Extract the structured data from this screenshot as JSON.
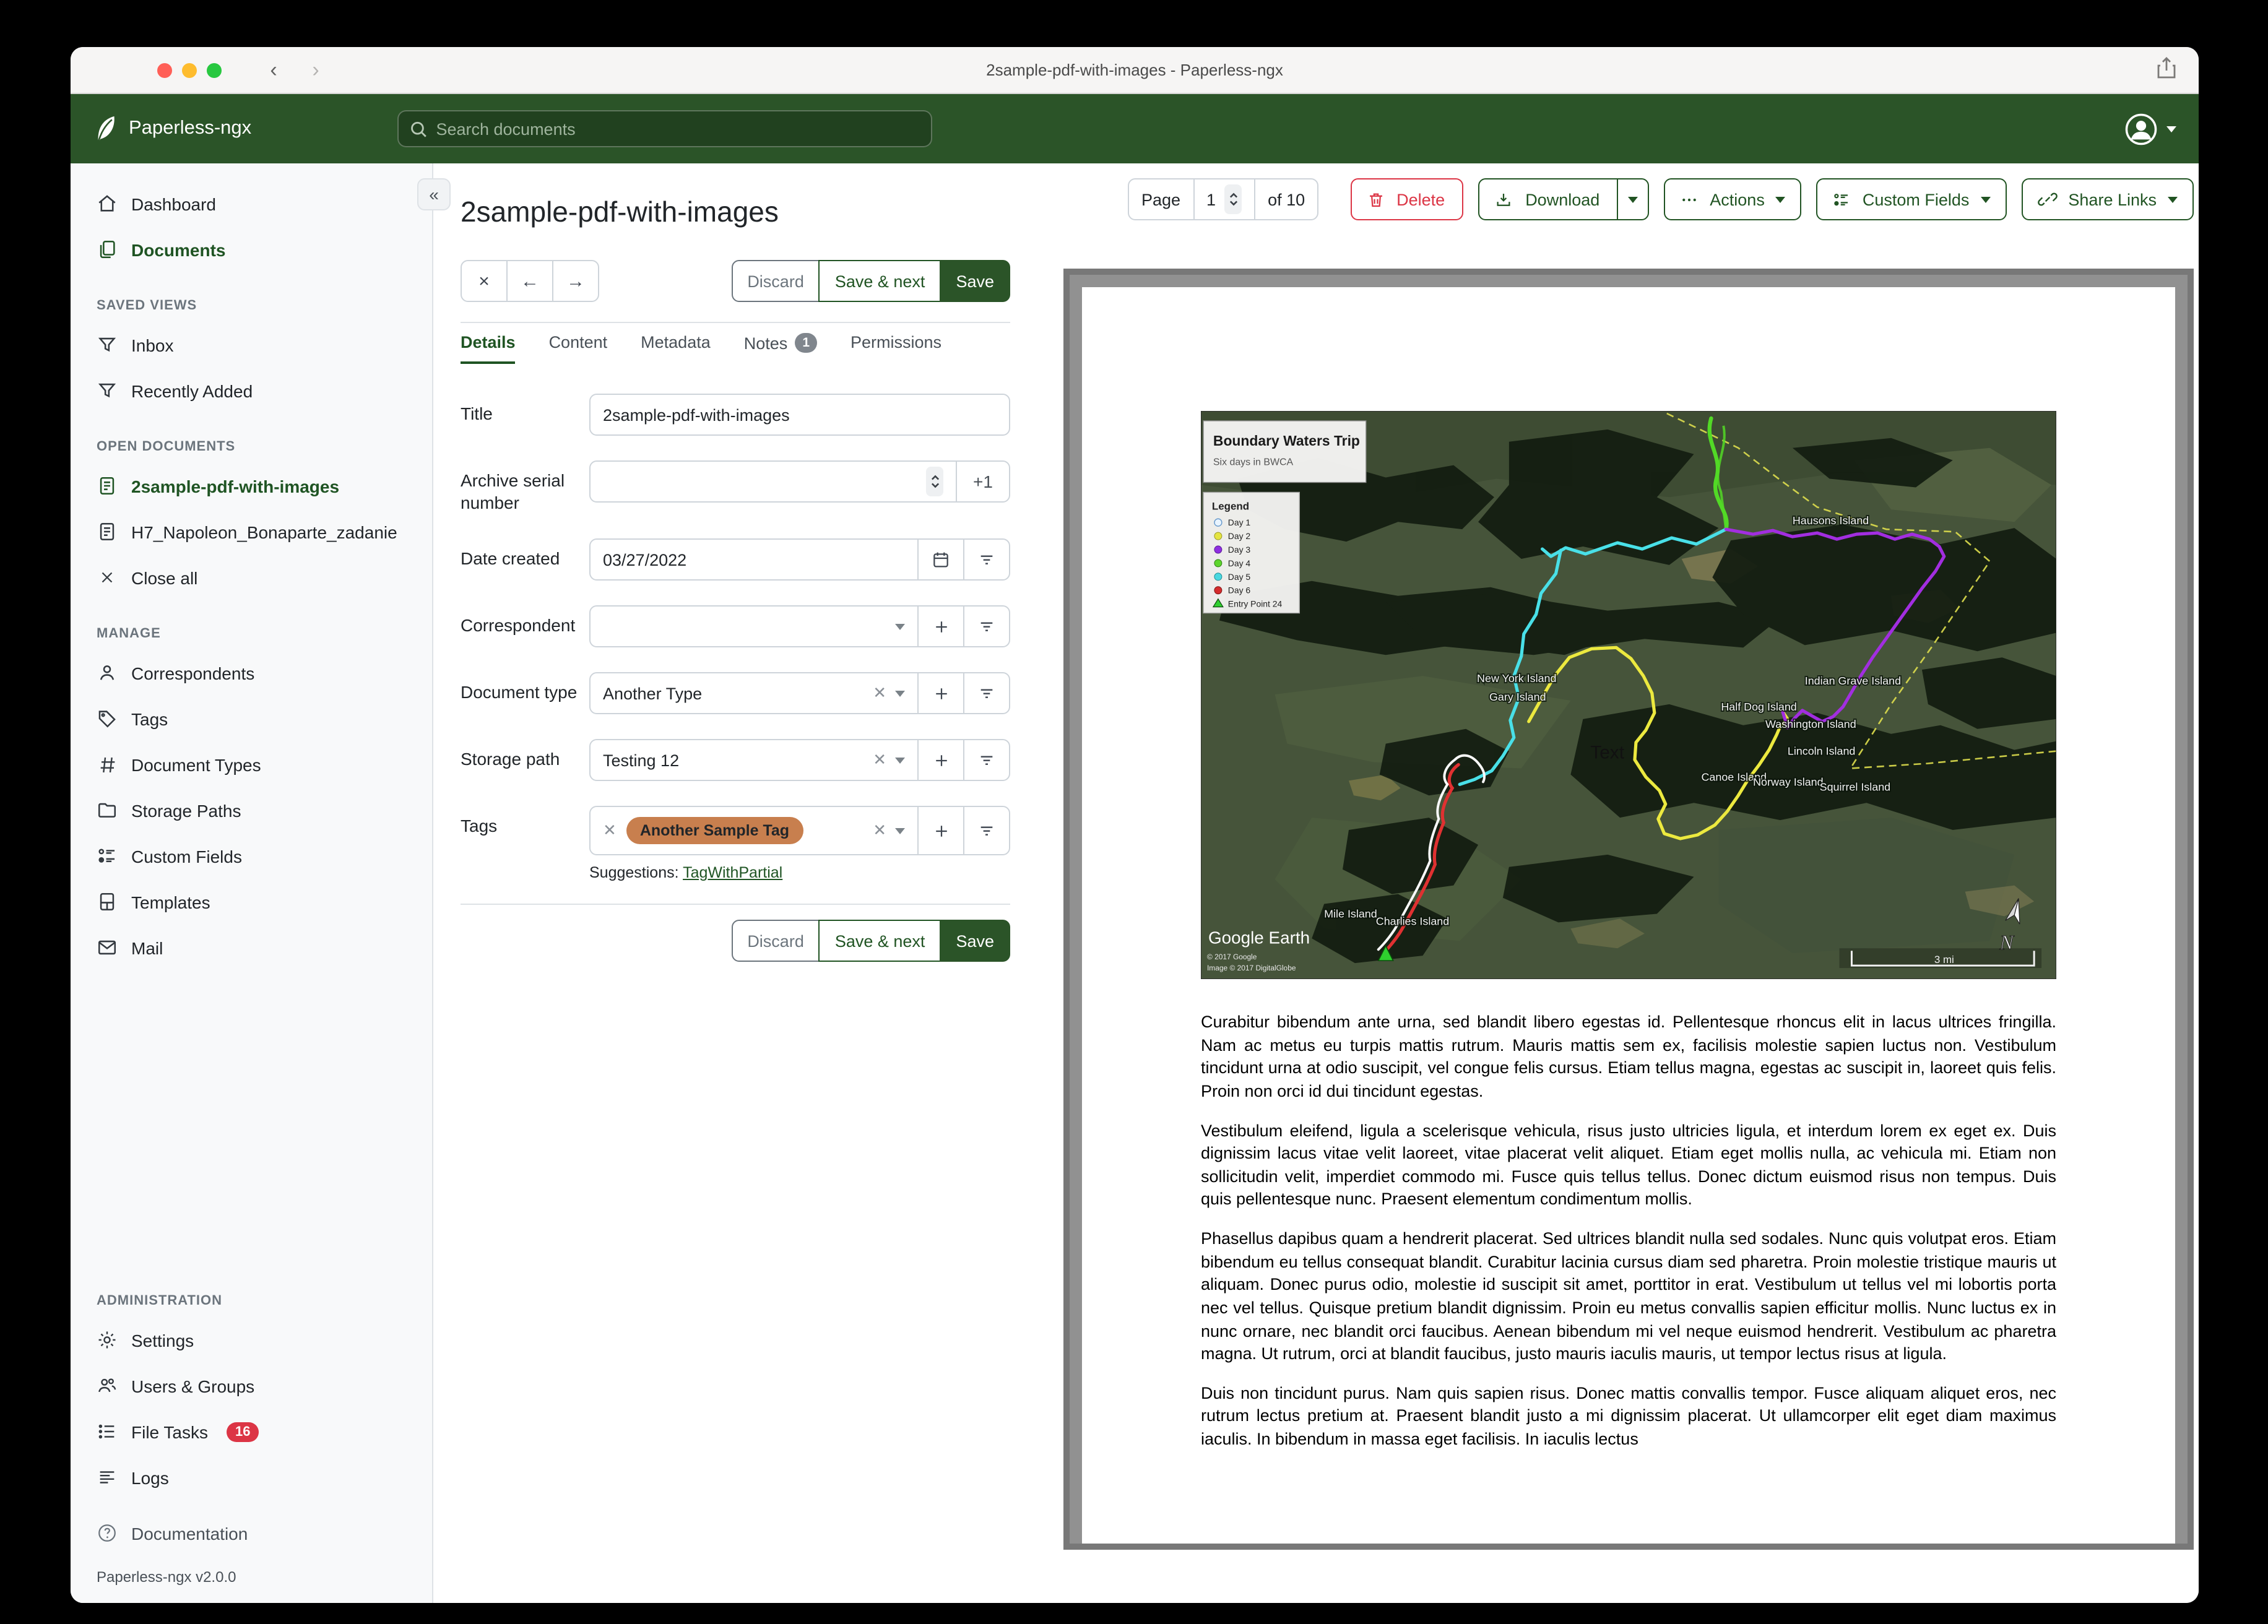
{
  "colors": {
    "accent_green": "#2b5428",
    "active_text_green": "#1f5423",
    "danger_red": "#dc3545",
    "tag_chip": "#c87f4e",
    "sidebar_bg": "#f8f9fa",
    "legend_day_colors": [
      "#e8f4ff",
      "#e4e441",
      "#8f2fe0",
      "#5dd52c",
      "#49d8e0",
      "#d42c2c",
      "#2fcf2f"
    ]
  },
  "window": {
    "title": "2sample-pdf-with-images - Paperless-ngx"
  },
  "header": {
    "brand": "Paperless-ngx",
    "search_placeholder": "Search documents"
  },
  "icons": {
    "close": "×",
    "back": "←",
    "forward": "→",
    "collapse": "«"
  },
  "sidebar": {
    "dashboard": "Dashboard",
    "documents": "Documents",
    "saved_views_header": "SAVED VIEWS",
    "inbox": "Inbox",
    "recently_added": "Recently Added",
    "open_documents_header": "OPEN DOCUMENTS",
    "open_doc_1": "2sample-pdf-with-images",
    "open_doc_2": "H7_Napoleon_Bonaparte_zadanie",
    "close_all": "Close all",
    "manage_header": "MANAGE",
    "correspondents": "Correspondents",
    "tags": "Tags",
    "document_types": "Document Types",
    "storage_paths": "Storage Paths",
    "custom_fields": "Custom Fields",
    "templates": "Templates",
    "mail": "Mail",
    "administration_header": "ADMINISTRATION",
    "settings": "Settings",
    "users_groups": "Users & Groups",
    "file_tasks": "File Tasks",
    "file_tasks_count": "16",
    "logs": "Logs",
    "documentation": "Documentation",
    "version": "Paperless-ngx v2.0.0"
  },
  "editor": {
    "title": "2sample-pdf-with-images",
    "discard": "Discard",
    "save_next": "Save & next",
    "save": "Save",
    "tabs": [
      {
        "label": "Details"
      },
      {
        "label": "Content"
      },
      {
        "label": "Metadata"
      },
      {
        "label": "Notes",
        "badge": "1"
      },
      {
        "label": "Permissions"
      }
    ],
    "fields": {
      "title_label": "Title",
      "title_value": "2sample-pdf-with-images",
      "asn_label": "Archive serial number",
      "asn_increment": "+1",
      "date_label": "Date created",
      "date_value": "03/27/2022",
      "correspondent_label": "Correspondent",
      "doctype_label": "Document type",
      "doctype_value": "Another Type",
      "storage_label": "Storage path",
      "storage_value": "Testing 12",
      "tags_label": "Tags",
      "tag_chip": "Another Sample Tag",
      "suggestions_label": "Suggestions:",
      "suggestion_link": "TagWithPartial"
    }
  },
  "preview": {
    "page_label": "Page",
    "page_value": "1",
    "page_total": "of 10",
    "delete": "Delete",
    "download": "Download",
    "actions": "Actions",
    "custom_fields": "Custom Fields",
    "share_links": "Share Links",
    "map": {
      "title": "Boundary Waters Trip",
      "subtitle": "Six days in BWCA",
      "legend_title": "Legend",
      "legend": [
        {
          "label": "Day 1",
          "color": "#e8f4ff"
        },
        {
          "label": "Day 2",
          "color": "#e4e441"
        },
        {
          "label": "Day 3",
          "color": "#8f2fe0"
        },
        {
          "label": "Day 4",
          "color": "#5dd52c"
        },
        {
          "label": "Day 5",
          "color": "#49d8e0"
        },
        {
          "label": "Day 6",
          "color": "#d42c2c"
        },
        {
          "label": "Entry Point 24",
          "color": "#2fcf2f"
        }
      ],
      "islands": [
        "Hausons Island",
        "New York Island",
        "Gary Island",
        "Indian Grave Island",
        "Half Dog Island",
        "Washington Island",
        "Lincoln Island",
        "Canoe Island",
        "Norway Island",
        "Squirrel Island",
        "Mile Island",
        "Charlies Island"
      ],
      "text_annotation": "Text",
      "credit_logo": "Google Earth",
      "credit_line1": "© 2017 Google",
      "credit_line2": "Image © 2017 DigitalGlobe",
      "north_label": "N",
      "scale_label": "3 mi"
    },
    "paragraphs": [
      "Curabitur bibendum ante urna, sed blandit libero egestas id. Pellentesque rhoncus elit in lacus ultrices fringilla. Nam ac metus eu turpis mattis rutrum. Mauris mattis sem ex, facilisis molestie sapien luctus non. Vestibulum tincidunt urna at odio suscipit, vel congue felis cursus. Etiam tellus magna, egestas ac suscipit in, laoreet quis felis. Proin non orci id dui tincidunt egestas.",
      "Vestibulum eleifend, ligula a scelerisque vehicula, risus justo ultricies ligula, et interdum lorem ex eget ex. Duis dignissim lacus vitae velit laoreet, vitae placerat velit aliquet. Etiam eget mollis nulla, ac vehicula mi. Etiam non sollicitudin velit, imperdiet commodo mi. Fusce quis tellus tellus. Donec dictum euismod risus non tempus. Duis quis pellentesque nunc. Praesent elementum condimentum mollis.",
      "Phasellus dapibus quam a hendrerit placerat. Sed ultrices blandit nulla sed sodales. Nunc quis volutpat eros. Etiam bibendum eu tellus consequat blandit. Curabitur lacinia cursus diam sed pharetra. Proin molestie tristique mauris ut aliquam. Donec purus odio, molestie id suscipit sit amet, porttitor in erat. Vestibulum ut tellus vel mi lobortis porta nec vel tellus. Quisque pretium blandit dignissim. Proin eu metus convallis sapien efficitur mollis. Nunc luctus ex in nunc ornare, nec blandit orci faucibus. Aenean bibendum mi vel neque euismod hendrerit. Vestibulum ac pharetra magna. Ut rutrum, orci at blandit faucibus, justo mauris iaculis mauris, ut tempor lectus risus at ligula.",
      "Duis non tincidunt purus. Nam quis sapien risus. Donec mattis convallis tempor. Fusce aliquam aliquet eros, nec rutrum lectus pretium at. Praesent blandit justo a mi dignissim placerat. Ut ullamcorper elit eget diam maximus iaculis. In bibendum in massa eget facilisis. In iaculis lectus"
    ]
  }
}
